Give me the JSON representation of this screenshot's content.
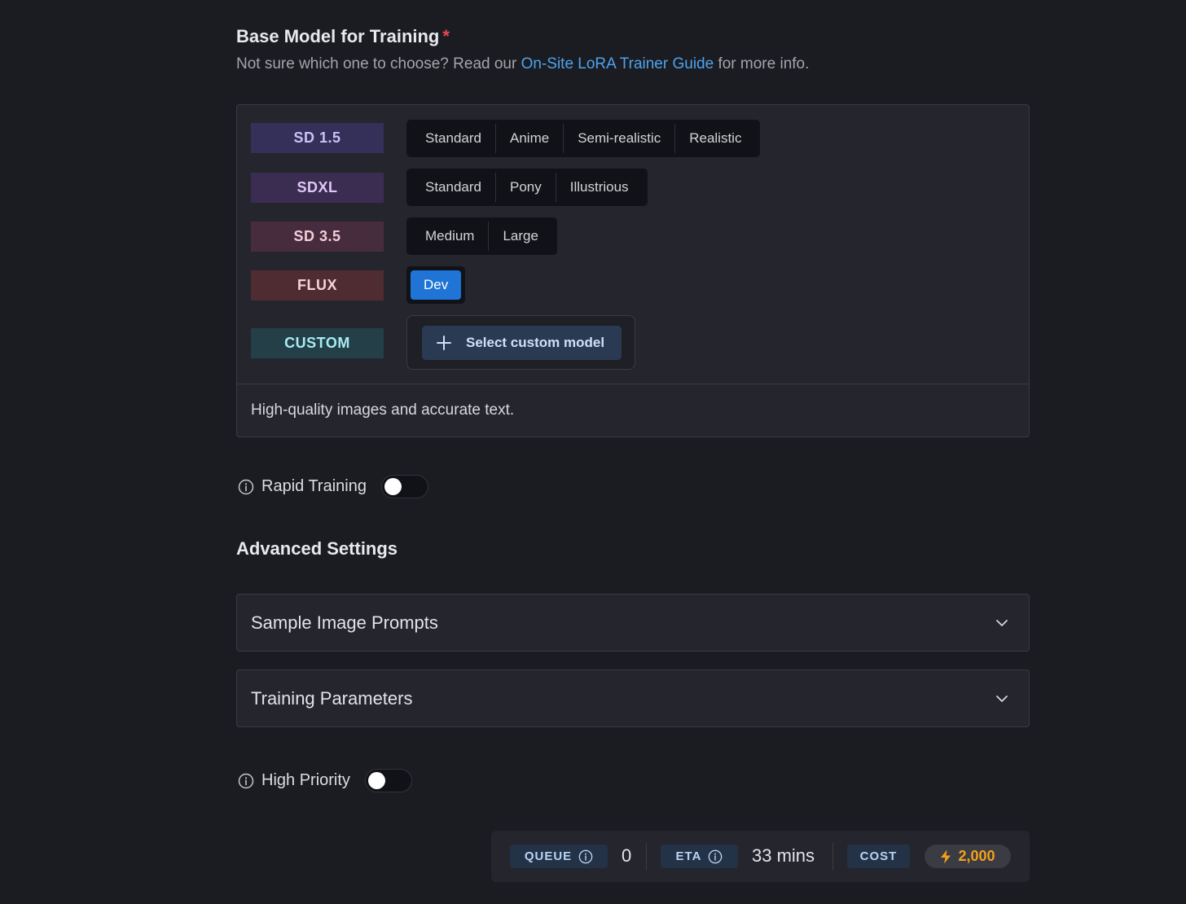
{
  "base_model": {
    "title": "Base Model for Training",
    "required_mark": "*",
    "subtitle_prefix": "Not sure which one to choose? Read our ",
    "guide_link": "On-Site LoRA Trainer Guide",
    "subtitle_suffix": " for more info.",
    "rows": [
      {
        "badge": "SD 1.5",
        "badge_bg": "#34305a",
        "badge_color": "#c9c2f6",
        "options": [
          "Standard",
          "Anime",
          "Semi-realistic",
          "Realistic"
        ],
        "selected": null
      },
      {
        "badge": "SDXL",
        "badge_bg": "#3b2c52",
        "badge_color": "#e0c6f5",
        "options": [
          "Standard",
          "Pony",
          "Illustrious"
        ],
        "selected": null
      },
      {
        "badge": "SD 3.5",
        "badge_bg": "#472c3d",
        "badge_color": "#f3ccd9",
        "options": [
          "Medium",
          "Large"
        ],
        "selected": null
      },
      {
        "badge": "FLUX",
        "badge_bg": "#4f2c32",
        "badge_color": "#f4d2d2",
        "options": [
          "Dev"
        ],
        "selected": "Dev"
      }
    ],
    "custom": {
      "badge": "CUSTOM",
      "badge_bg": "#243f47",
      "badge_color": "#a6ecf2",
      "button_label": "Select custom model"
    },
    "description": "High-quality images and accurate text."
  },
  "rapid_training": {
    "label": "Rapid Training",
    "enabled": false
  },
  "advanced": {
    "title": "Advanced Settings",
    "sections": [
      "Sample Image Prompts",
      "Training Parameters"
    ]
  },
  "high_priority": {
    "label": "High Priority",
    "enabled": false
  },
  "stats": {
    "queue_label": "QUEUE",
    "queue_value": "0",
    "eta_label": "ETA",
    "eta_value": "33 mins",
    "cost_label": "COST",
    "cost_value": "2,000"
  },
  "colors": {
    "accent": "#1f74d6",
    "link": "#4ea3ee",
    "cost": "#f3a11a",
    "required": "#e5484d"
  },
  "icons": {
    "info": "info-circle-icon",
    "chevron": "chevron-down-icon",
    "plus": "plus-icon",
    "bolt": "lightning-bolt-icon"
  }
}
